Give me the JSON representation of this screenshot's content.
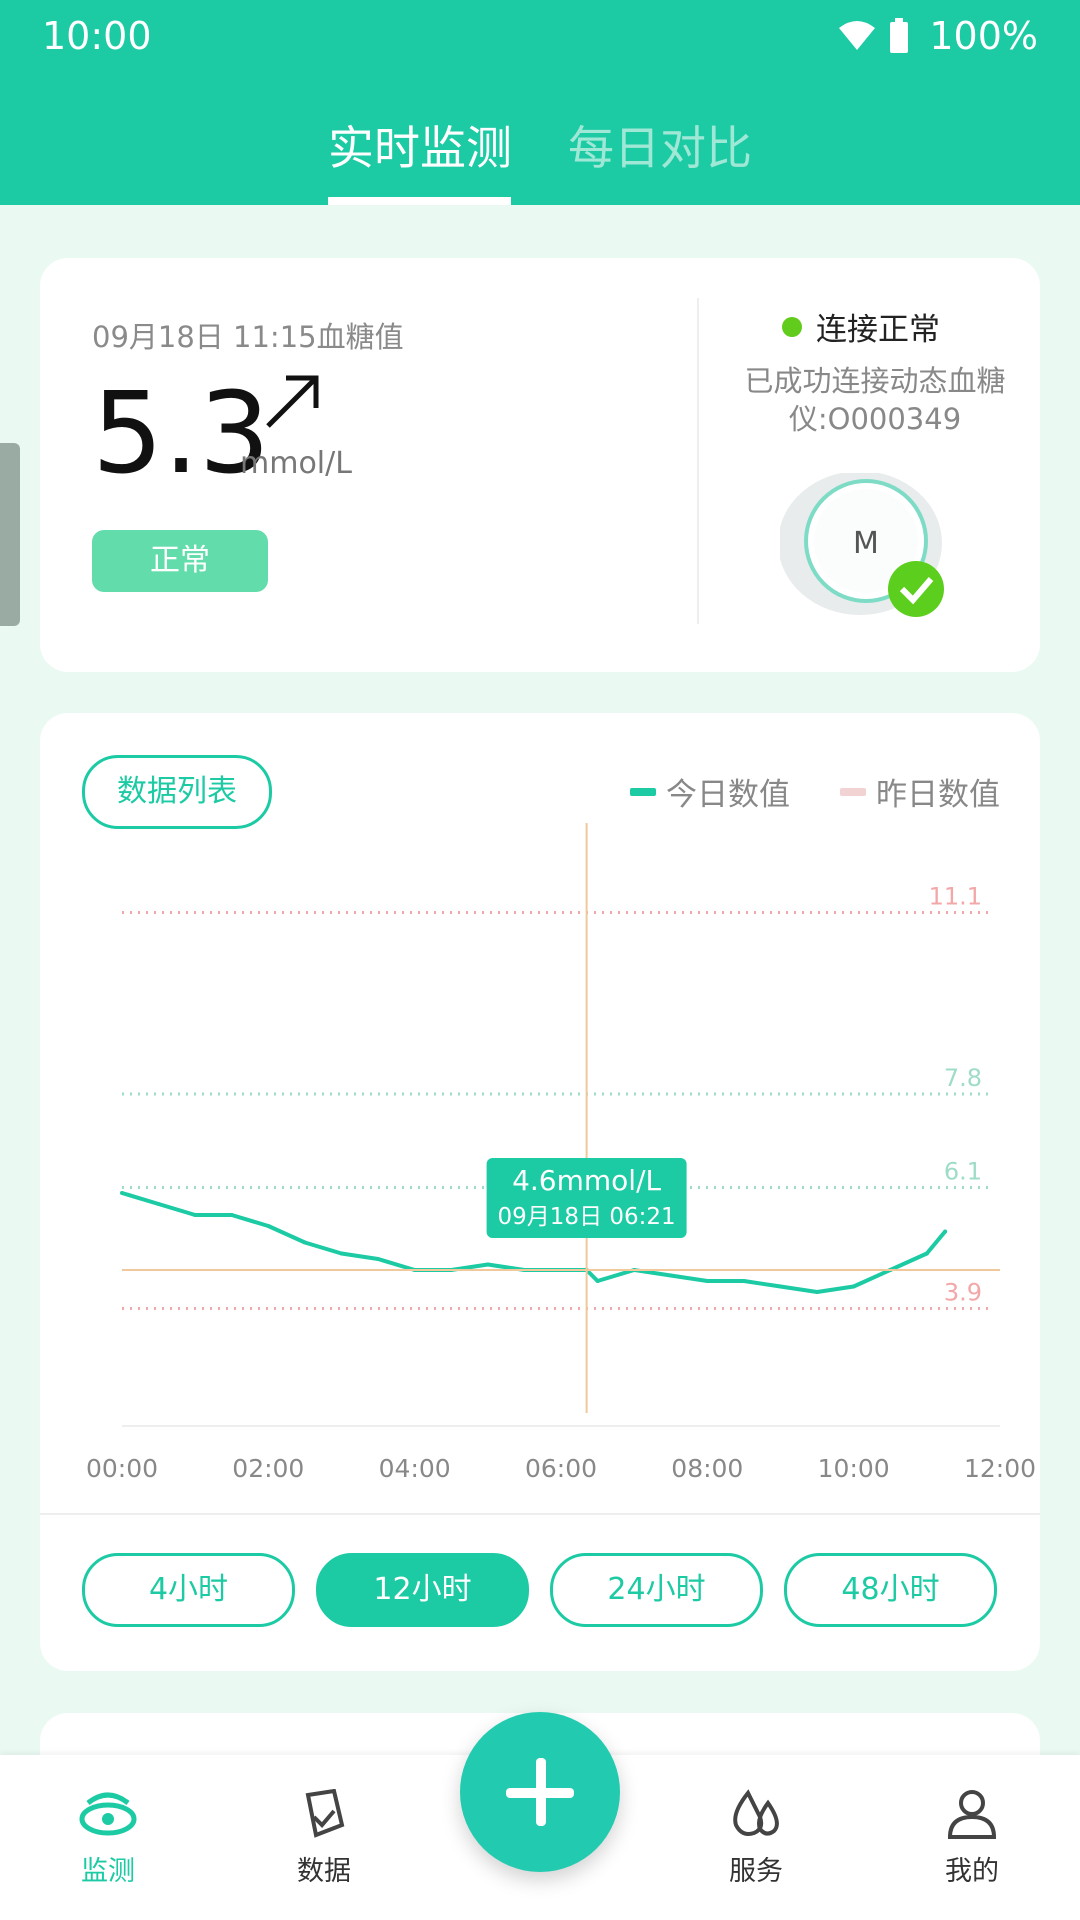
{
  "status_bar": {
    "time": "10:00",
    "battery": "100%"
  },
  "tabs": [
    {
      "label": "实时监测"
    },
    {
      "label": "每日对比"
    }
  ],
  "reading": {
    "date_label": "09月18日 11:15血糖值",
    "value": "5.3",
    "unit": "mmol/L",
    "status": "正常"
  },
  "connection": {
    "status": "连接正常",
    "description": "已成功连接动态血糖仪:O000349"
  },
  "chart_controls": {
    "list_button": "数据列表",
    "legend": [
      {
        "label": "今日数值",
        "color": "#1ccaa4"
      },
      {
        "label": "昨日数值",
        "color": "#f1d3d3"
      }
    ],
    "tooltip": {
      "value": "4.6mmol/L",
      "time": "09月18日 06:21"
    }
  },
  "chart_data": {
    "type": "line",
    "series": [
      {
        "name": "今日数值",
        "x": [
          "00:00",
          "00:30",
          "01:00",
          "01:30",
          "02:00",
          "02:30",
          "03:00",
          "03:30",
          "04:00",
          "04:30",
          "05:00",
          "05:30",
          "06:00",
          "06:21",
          "06:30",
          "07:00",
          "07:30",
          "08:00",
          "08:30",
          "09:00",
          "09:30",
          "10:00",
          "10:30",
          "11:00",
          "11:15"
        ],
        "values": [
          6.0,
          5.8,
          5.6,
          5.6,
          5.4,
          5.1,
          4.9,
          4.8,
          4.6,
          4.6,
          4.7,
          4.6,
          4.6,
          4.6,
          4.4,
          4.6,
          4.5,
          4.4,
          4.4,
          4.3,
          4.2,
          4.3,
          4.6,
          4.9,
          5.3
        ]
      }
    ],
    "reference_lines": [
      {
        "value": 11.1,
        "label": "11.1",
        "color": "#f2a8a8"
      },
      {
        "value": 7.8,
        "label": "7.8",
        "color": "#9fdcc8"
      },
      {
        "value": 6.1,
        "label": "6.1",
        "color": "#9fdcc8"
      },
      {
        "value": 3.9,
        "label": "3.9",
        "color": "#f2a8a8"
      }
    ],
    "x_ticks": [
      "00:00",
      "02:00",
      "04:00",
      "06:00",
      "08:00",
      "10:00",
      "12:00"
    ],
    "xlim": [
      0,
      12
    ],
    "ylim": [
      2.0,
      12.0
    ]
  },
  "ranges": [
    {
      "label": "4小时",
      "active": false
    },
    {
      "label": "12小时",
      "active": true
    },
    {
      "label": "24小时",
      "active": false
    },
    {
      "label": "48小时",
      "active": false
    }
  ],
  "nav": [
    {
      "label": "监测",
      "icon": "monitor-icon",
      "active": true
    },
    {
      "label": "数据",
      "icon": "data-icon",
      "active": false
    },
    {
      "label": "服务",
      "icon": "drops-icon",
      "active": false
    },
    {
      "label": "我的",
      "icon": "user-icon",
      "active": false
    }
  ],
  "fab": {
    "icon": "plus-icon"
  }
}
